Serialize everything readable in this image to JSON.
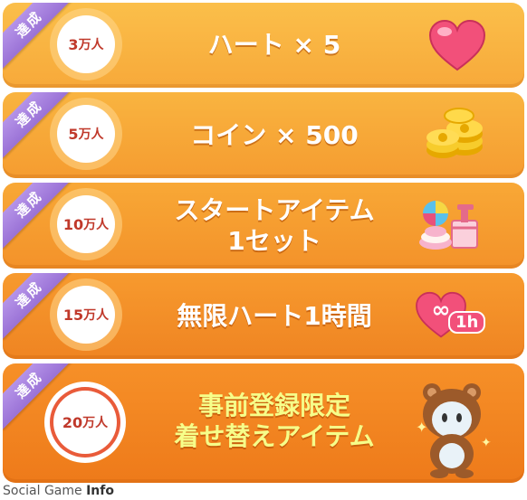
{
  "rewards": [
    {
      "badge": "達成",
      "goal": "3",
      "unit": "万人",
      "label1": "ハート × 5",
      "label2": "",
      "icon": "heart-icon"
    },
    {
      "badge": "達成",
      "goal": "5",
      "unit": "万人",
      "label1": "コイン × 500",
      "label2": "",
      "icon": "coins-icon"
    },
    {
      "badge": "達成",
      "goal": "10",
      "unit": "万人",
      "label1": "スタートアイテム",
      "label2": "1セット",
      "icon": "start-items-icon"
    },
    {
      "badge": "達成",
      "goal": "15",
      "unit": "万人",
      "label1": "無限ハート1時間",
      "label2": "",
      "icon": "infinite-heart-icon",
      "icon_text": "1h"
    },
    {
      "badge": "達成",
      "goal": "20",
      "unit": "万人",
      "label1": "事前登録限定",
      "label2": "着せ替えアイテム",
      "icon": "bear-costume-icon"
    }
  ],
  "watermark": {
    "text": "Social Game ",
    "bold": "Info"
  },
  "colors": {
    "badge": "#9a72d6",
    "goal_text": "#c0392b",
    "highlight": "#f6ff8a"
  }
}
